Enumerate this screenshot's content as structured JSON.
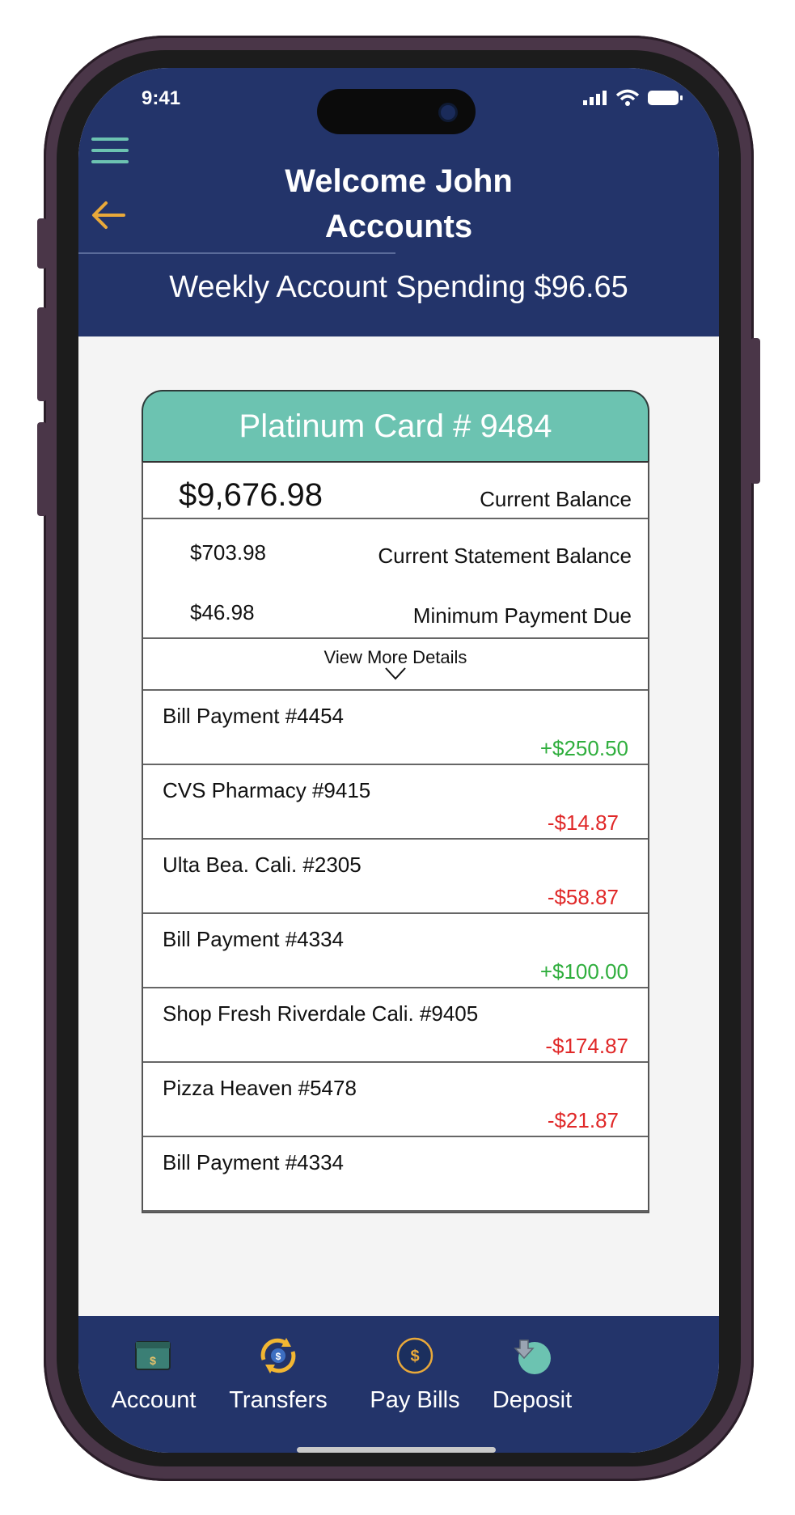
{
  "status_bar": {
    "time": "9:41"
  },
  "header": {
    "welcome": "Welcome John",
    "page_title": "Accounts",
    "weekly_spending": "Weekly Account Spending $96.65"
  },
  "card": {
    "title": "Platinum Card # 9484",
    "current_balance": "$9,676.98",
    "current_balance_label": "Current Balance",
    "statement_balance": "$703.98",
    "statement_balance_label": "Current Statement Balance",
    "minimum_payment": "$46.98",
    "minimum_payment_label": "Minimum Payment Due",
    "view_more_label": "View More Details"
  },
  "transactions": [
    {
      "name": "Bill Payment #4454",
      "amount": "+$250.50"
    },
    {
      "name": "CVS Pharmacy #9415",
      "amount": "-$14.87"
    },
    {
      "name": "Ulta Bea. Cali. #2305",
      "amount": "-$58.87"
    },
    {
      "name": "Bill Payment #4334",
      "amount": "+$100.00"
    },
    {
      "name": "Shop Fresh Riverdale Cali. #9405",
      "amount": "-$174.87"
    },
    {
      "name": "Pizza Heaven #5478",
      "amount": "-$21.87"
    },
    {
      "name": "Bill Payment #4334",
      "amount": ""
    }
  ],
  "tabs": [
    {
      "label": "Account",
      "icon": "wallet-icon"
    },
    {
      "label": "Transfers",
      "icon": "transfer-icon"
    },
    {
      "label": "Pay Bills",
      "icon": "coin-icon"
    },
    {
      "label": "Deposit",
      "icon": "deposit-icon"
    }
  ],
  "colors": {
    "header_bg": "#23346a",
    "accent_teal": "#6cc3b1",
    "back_arrow": "#e9a93a",
    "positive": "#2fae3d",
    "negative": "#e02828"
  }
}
